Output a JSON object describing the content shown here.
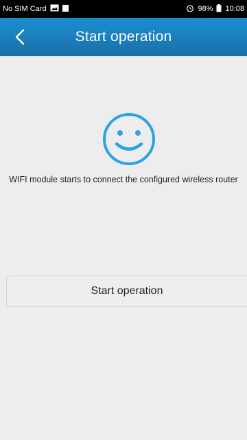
{
  "status_bar": {
    "carrier": "No SIM Card",
    "battery": "98%",
    "time": "10:08"
  },
  "header": {
    "title": "Start operation",
    "back_icon": "chevron-left-icon"
  },
  "main": {
    "smiley_icon": "smiley-face-icon",
    "message": "WIFI module starts to connect the configured wireless router",
    "start_button_label": "Start operation"
  },
  "colors": {
    "header_top": "#1c8fd1",
    "header_bottom": "#1a6fa6",
    "icon_blue": "#2aa3e6",
    "background": "#ededed"
  }
}
